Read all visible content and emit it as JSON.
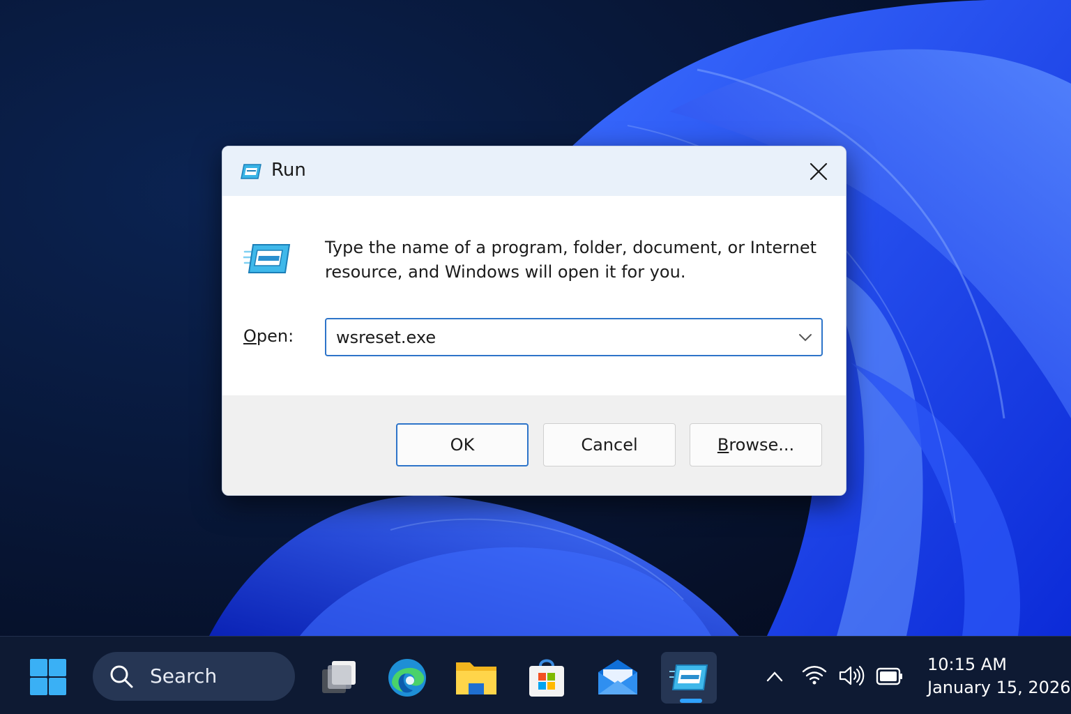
{
  "colors": {
    "accent": "#2d74c9",
    "wallpaper_blue": "#1f4fff",
    "taskbar_bg": "#0e1a33"
  },
  "dialog": {
    "title": "Run",
    "icon": "run-app-icon",
    "description": "Type the name of a program, folder, document, or Internet resource, and Windows will open it for you.",
    "open_label_accel": "O",
    "open_label_rest": "pen:",
    "open_value": "wsreset.exe",
    "buttons": {
      "ok": "OK",
      "cancel": "Cancel",
      "browse_accel": "B",
      "browse_rest": "rowse..."
    }
  },
  "taskbar": {
    "search_placeholder": "Search",
    "apps": [
      "start-icon",
      "task-view-icon",
      "edge-icon",
      "file-explorer-icon",
      "store-icon",
      "mail-icon",
      "run-app-icon"
    ],
    "clock": {
      "time": "10:15 AM",
      "date": "January 15, 2026"
    }
  }
}
